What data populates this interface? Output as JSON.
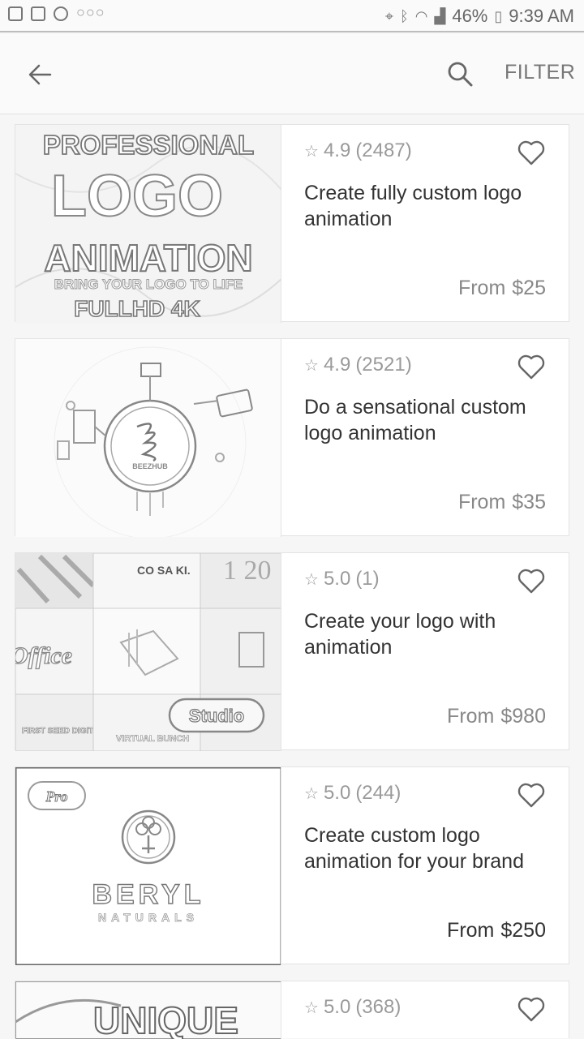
{
  "status_bar": {
    "battery": "46%",
    "time": "9:39 AM"
  },
  "app_bar": {
    "filter_label": "FILTER"
  },
  "gigs": [
    {
      "rating": "4.9",
      "reviews": "(2487)",
      "title": "Create fully custom logo animation",
      "price_prefix": "From",
      "price": "$25",
      "thumb": {
        "line1": "PROFESSIONAL",
        "line2": "LOGO",
        "line3": "ANIMATION",
        "line4": "BRING YOUR LOGO TO LIFE",
        "line5": "FULLHD  4K"
      }
    },
    {
      "rating": "4.9",
      "reviews": "(2521)",
      "title": "Do a sensational custom logo animation",
      "price_prefix": "From",
      "price": "$35",
      "thumb": {
        "badge_text": "BEEZHUB"
      }
    },
    {
      "rating": "5.0",
      "reviews": "(1)",
      "title": "Create your logo with animation",
      "price_prefix": "From",
      "price": "$980",
      "thumb": {
        "t1": "CO SA KI.",
        "t2": "1 20",
        "t3": "Office",
        "t4": "Studio",
        "t5": "VIRTUAL BUNCH",
        "t6": "FIRST SEED DIGITAL"
      }
    },
    {
      "rating": "5.0",
      "reviews": "(244)",
      "title": "Create custom logo animation for your brand",
      "price_prefix": "From",
      "price": "$250",
      "thumb": {
        "pro": "Pro",
        "brand": "BERYL",
        "sub": "NATURALS"
      }
    },
    {
      "rating": "5.0",
      "reviews": "(368)",
      "thumb": {
        "text": "UNIQUE"
      }
    }
  ]
}
